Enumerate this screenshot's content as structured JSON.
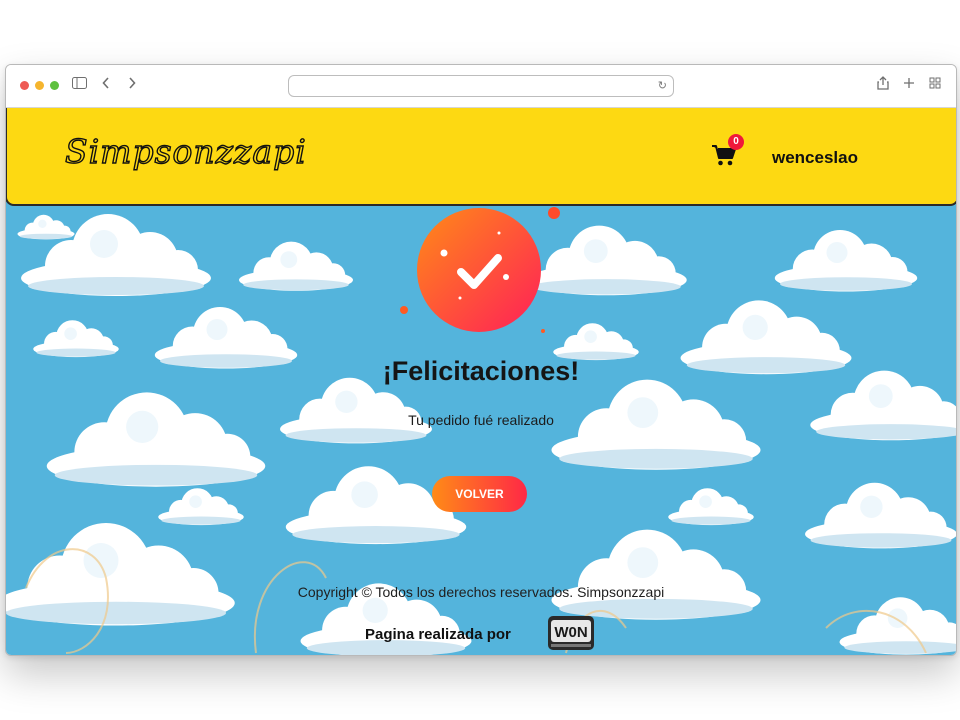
{
  "browser": {
    "address": "",
    "icons": [
      "sidebar-icon",
      "back-icon",
      "forward-icon",
      "reload-icon",
      "share-icon",
      "new-tab-icon",
      "tabs-overview-icon"
    ]
  },
  "header": {
    "logo_text": "Simpsonzzapi",
    "cart_count": "0",
    "username": "wenceslao",
    "background": "#fdd912"
  },
  "main": {
    "title": "¡Felicitaciones!",
    "subtitle": "Tu pedido fué realizado",
    "button_label": "VOLVER",
    "icon": "check-icon"
  },
  "footer": {
    "copyright": "Copyright © Todos los derechos reservados. Simpsonzzapi",
    "made_by": "Pagina realizada por",
    "made_by_logo": "W0N"
  },
  "colors": {
    "accent_start": "#ff8b17",
    "accent_end": "#ff2846",
    "sky": "#54b4dc"
  }
}
